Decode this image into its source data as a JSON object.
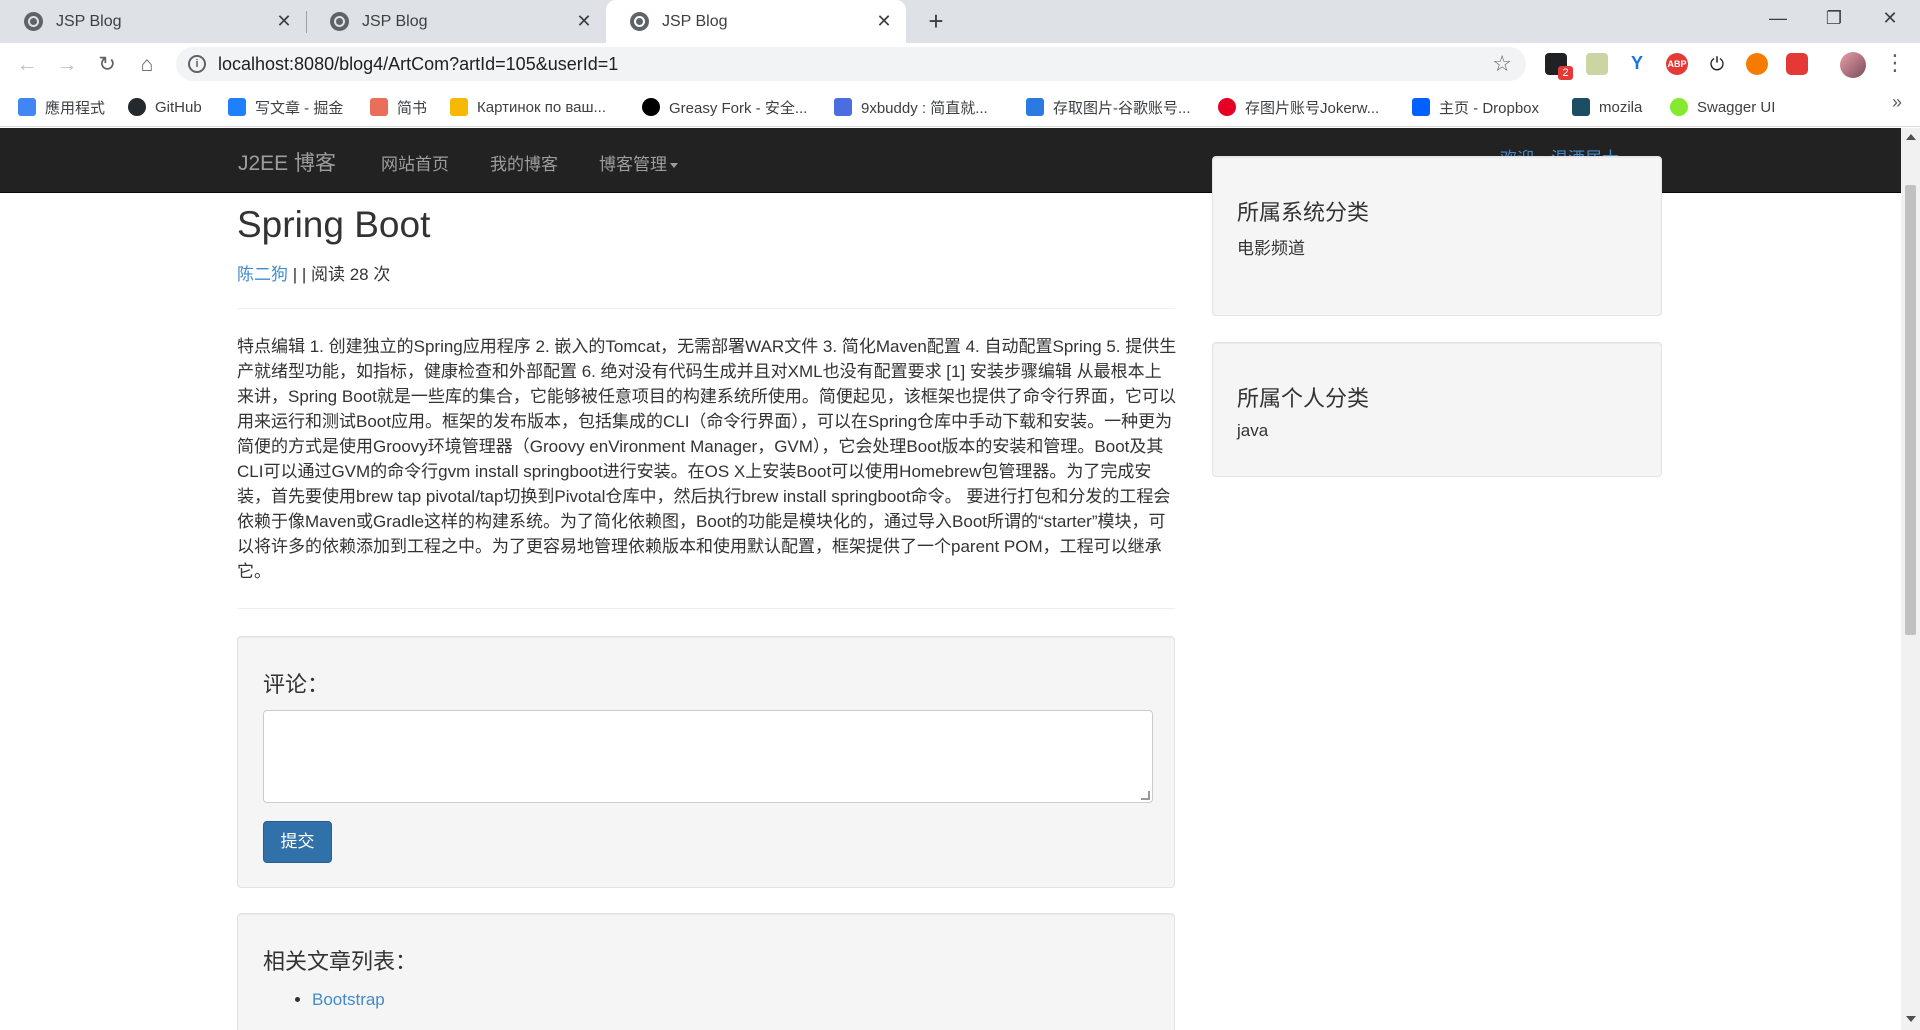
{
  "browser": {
    "tabs": [
      {
        "title": "JSP Blog"
      },
      {
        "title": "JSP Blog"
      },
      {
        "title": "JSP Blog"
      }
    ],
    "url": "localhost:8080/blog4/ArtCom?artId=105&userId=1",
    "extension_badge": "2",
    "bookmarks": [
      {
        "label": "應用程式",
        "icon": "apps-grid-icon",
        "color": "#4285f4"
      },
      {
        "label": "GitHub",
        "icon": "github-icon",
        "color": "#24292e"
      },
      {
        "label": "写文章 - 掘金",
        "icon": "juejin-icon",
        "color": "#1e80ff"
      },
      {
        "label": "简书",
        "icon": "jianshu-icon",
        "color": "#ea6f5a"
      },
      {
        "label": "Картинок по ваш...",
        "icon": "image-icon",
        "color": "#f6b800"
      },
      {
        "label": "Greasy Fork - 安全...",
        "icon": "greasyfork-icon",
        "color": "#000000"
      },
      {
        "label": "9xbuddy : 简直就...",
        "icon": "doc-icon",
        "color": "#4a6ee0"
      },
      {
        "label": "存取图片-谷歌账号...",
        "icon": "ibb-icon",
        "color": "#2a7ae2"
      },
      {
        "label": "存图片账号Jokerw...",
        "icon": "pinterest-icon",
        "color": "#e60023"
      },
      {
        "label": "主页 - Dropbox",
        "icon": "dropbox-icon",
        "color": "#0061ff"
      },
      {
        "label": "mozila",
        "icon": "mozilla-icon",
        "color": "#1c4e63"
      },
      {
        "label": "Swagger UI",
        "icon": "swagger-icon",
        "color": "#85ea2d"
      }
    ]
  },
  "navbar": {
    "brand": "J2EE 博客",
    "links": [
      "网站首页",
      "我的博客",
      "博客管理"
    ],
    "user": "欢迎，温酒居士"
  },
  "article": {
    "title": "Spring Boot",
    "author": "陈二狗",
    "meta_rest": " | | 阅读 28 次",
    "body": "特点编辑 1. 创建独立的Spring应用程序 2. 嵌入的Tomcat，无需部署WAR文件 3. 简化Maven配置 4. 自动配置Spring 5. 提供生产就绪型功能，如指标，健康检查和外部配置 6. 绝对没有代码生成并且对XML也没有配置要求 [1] 安装步骤编辑 从最根本上来讲，Spring Boot就是一些库的集合，它能够被任意项目的构建系统所使用。简便起见，该框架也提供了命令行界面，它可以用来运行和测试Boot应用。框架的发布版本，包括集成的CLI（命令行界面），可以在Spring仓库中手动下载和安装。一种更为简便的方式是使用Groovy环境管理器（Groovy enVironment Manager，GVM），它会处理Boot版本的安装和管理。Boot及其CLI可以通过GVM的命令行gvm install springboot进行安装。在OS X上安装Boot可以使用Homebrew包管理器。为了完成安装，首先要使用brew tap pivotal/tap切换到Pivotal仓库中，然后执行brew install springboot命令。 要进行打包和分发的工程会依赖于像Maven或Gradle这样的构建系统。为了简化依赖图，Boot的功能是模块化的，通过导入Boot所谓的“starter”模块，可以将许多的依赖添加到工程之中。为了更容易地管理依赖版本和使用默认配置，框架提供了一个parent POM，工程可以继承它。"
  },
  "comment": {
    "label": "评论：",
    "submit": "提交"
  },
  "related": {
    "label": "相关文章列表：",
    "items": [
      "Bootstrap"
    ]
  },
  "sidebar": {
    "system_category_title": "所属系统分类",
    "system_category": "电影频道",
    "personal_category_title": "所属个人分类",
    "personal_category": "java"
  },
  "colors": {
    "navbar_bg": "#222222",
    "link": "#428bca",
    "button": "#3071a9"
  }
}
